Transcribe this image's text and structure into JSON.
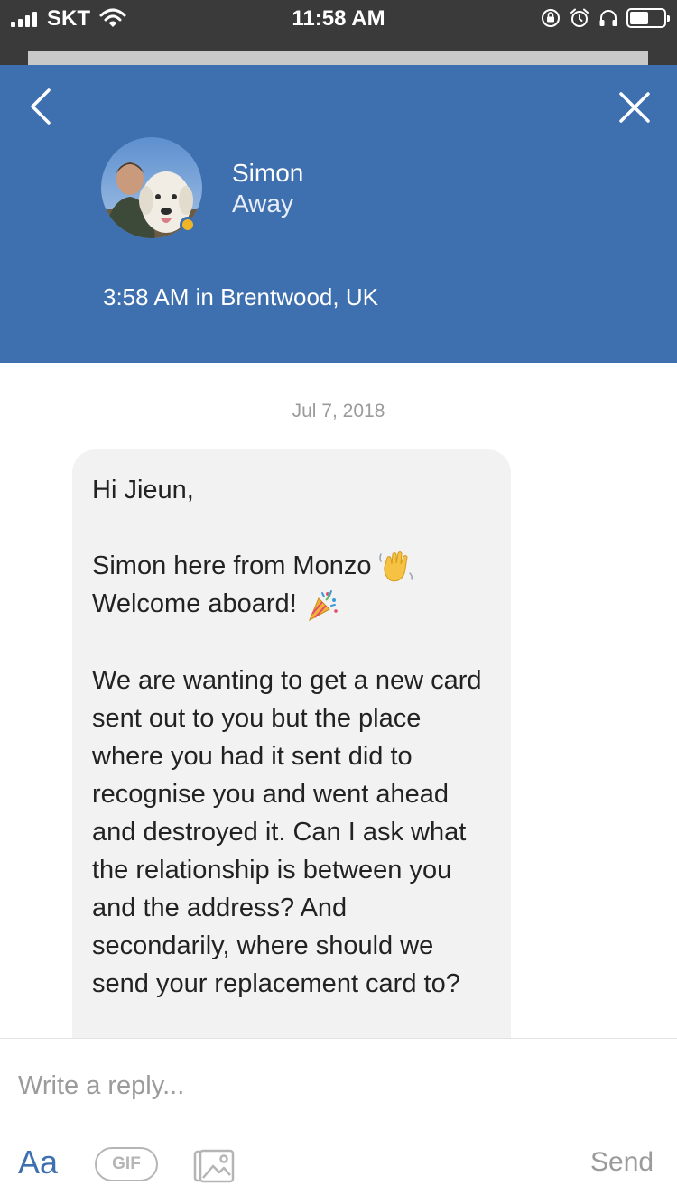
{
  "status_bar": {
    "carrier": "SKT",
    "time": "11:58 AM",
    "battery_level": 0.55
  },
  "header": {
    "contact_name": "Simon",
    "presence": "Away",
    "local_time": "3:58 AM in Brentwood, UK"
  },
  "conversation": {
    "date": "Jul 7, 2018",
    "message": {
      "greeting": "Hi Jieun,",
      "intro_line": "Simon here from Monzo",
      "welcome_line": "Welcome aboard!",
      "body": "We are wanting to get a new card sent out to you but the place where you had it sent did to recognise you and went ahead and destroyed it.  Can I ask what the relationship is between you and the address?  And secondarily, where should we send your replacement card to?"
    }
  },
  "composer": {
    "placeholder": "Write a reply...",
    "format_label": "Aa",
    "gif_label": "GIF",
    "send_label": "Send"
  },
  "colors": {
    "header_bg": "#3e6fae",
    "status_bar_bg": "#3a3a3a",
    "bubble_bg": "#f2f2f2",
    "presence_away": "#f0b429"
  }
}
